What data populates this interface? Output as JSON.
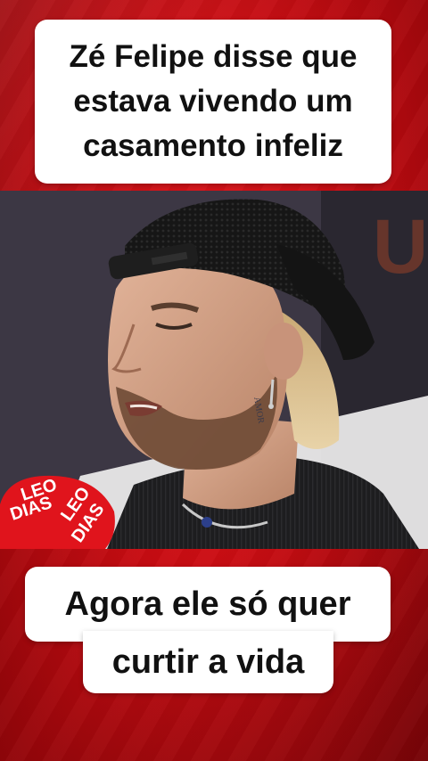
{
  "captions": {
    "top_line1": "Zé Felipe disse que",
    "top_line2": "estava vivendo um",
    "top_line3": "casamento infeliz",
    "bottom_line1": "Agora ele só quer",
    "bottom_line2": "curtir a vida"
  },
  "video": {
    "backdrop_text": "UN",
    "mic_flag_text_line1": "LEO",
    "mic_flag_text_line2": "DIAS",
    "mic_flag_text_line3": "LEO",
    "mic_flag_text_line4": "DIAS",
    "neck_tattoo_text": "AMOR"
  },
  "colors": {
    "background_red": "#d3121a",
    "caption_bg": "#ffffff",
    "caption_text": "#111111",
    "mic_red": "#e0141c"
  }
}
